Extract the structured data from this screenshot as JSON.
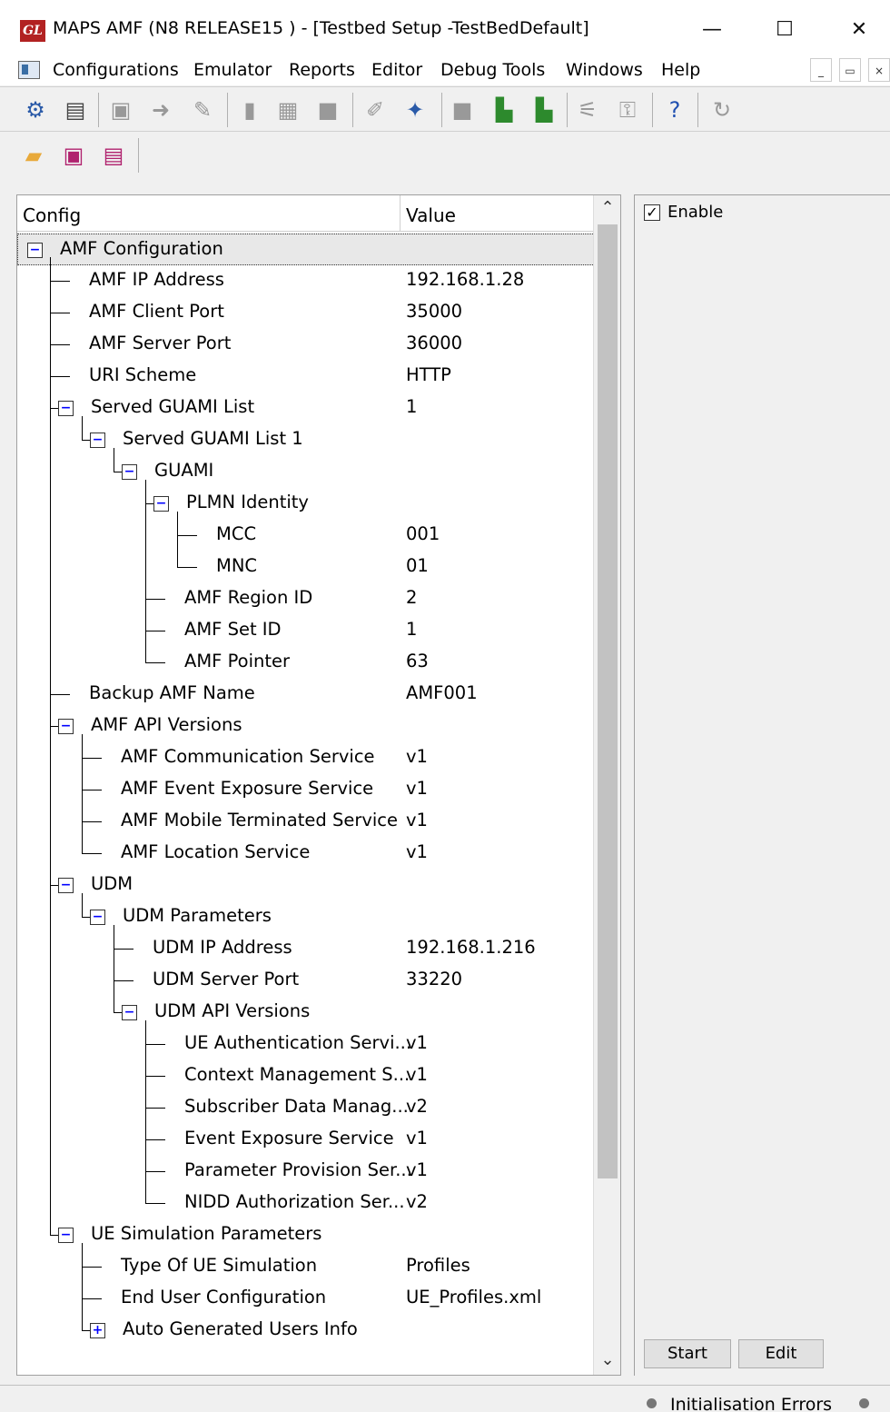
{
  "window": {
    "title": "MAPS AMF (N8 RELEASE15 ) - [Testbed Setup -TestBedDefault]",
    "logo_text": "GL",
    "minimize": "—",
    "maximize": "☐",
    "close": "✕"
  },
  "menu": {
    "items": [
      "Configurations",
      "Emulator",
      "Reports",
      "Editor",
      "Debug Tools",
      "Windows",
      "Help"
    ],
    "mdi_min": "_",
    "mdi_restore": "▭",
    "mdi_close": "×"
  },
  "tree": {
    "headers": {
      "config": "Config",
      "value": "Value"
    },
    "rows": [
      {
        "label": "AMF Configuration",
        "value": ""
      },
      {
        "label": "AMF IP Address",
        "value": "192.168.1.28"
      },
      {
        "label": "AMF Client Port",
        "value": "35000"
      },
      {
        "label": "AMF Server Port",
        "value": "36000"
      },
      {
        "label": "URI Scheme",
        "value": "HTTP"
      },
      {
        "label": "Served GUAMI List",
        "value": "1"
      },
      {
        "label": "Served GUAMI List 1",
        "value": ""
      },
      {
        "label": "GUAMI",
        "value": ""
      },
      {
        "label": "PLMN Identity",
        "value": ""
      },
      {
        "label": "MCC",
        "value": "001"
      },
      {
        "label": "MNC",
        "value": "01"
      },
      {
        "label": "AMF Region ID",
        "value": "2"
      },
      {
        "label": "AMF Set ID",
        "value": "1"
      },
      {
        "label": "AMF Pointer",
        "value": "63"
      },
      {
        "label": "Backup AMF Name",
        "value": "AMF001"
      },
      {
        "label": "AMF API Versions",
        "value": ""
      },
      {
        "label": "AMF Communication Service",
        "value": "v1"
      },
      {
        "label": "AMF Event Exposure Service",
        "value": "v1"
      },
      {
        "label": "AMF Mobile Terminated Service",
        "value": "v1"
      },
      {
        "label": "AMF  Location Service",
        "value": "v1"
      },
      {
        "label": "UDM",
        "value": ""
      },
      {
        "label": "UDM Parameters",
        "value": ""
      },
      {
        "label": "UDM IP Address",
        "value": "192.168.1.216"
      },
      {
        "label": "UDM Server Port",
        "value": "33220"
      },
      {
        "label": "UDM API Versions",
        "value": ""
      },
      {
        "label": "UE Authentication Servi...",
        "value": "v1"
      },
      {
        "label": "Context Management S...",
        "value": "v1"
      },
      {
        "label": "Subscriber Data Manag...",
        "value": "v2"
      },
      {
        "label": "Event Exposure Service",
        "value": "v1"
      },
      {
        "label": "Parameter Provision Ser...",
        "value": "v1"
      },
      {
        "label": "NIDD Authorization Ser...",
        "value": "v2"
      },
      {
        "label": "UE Simulation Parameters",
        "value": ""
      },
      {
        "label": "Type Of UE Simulation",
        "value": "Profiles"
      },
      {
        "label": "End User Configuration",
        "value": "UE_Profiles.xml"
      },
      {
        "label": "Auto Generated Users Info",
        "value": ""
      }
    ]
  },
  "right_panel": {
    "enable_label": "Enable",
    "enable_checked": "✓",
    "start_button": "Start",
    "edit_button": "Edit"
  },
  "status": {
    "text": "Initialisation Errors"
  },
  "toolbar": {
    "icons": [
      "settings-gear-icon",
      "notebook-icon",
      "load-icon",
      "run-icon",
      "edit-run-icon",
      "stop-icon",
      "paste-icon",
      "blank-icon",
      "pen-icon",
      "wand-icon",
      "gray-block-icon",
      "doc-c-icon",
      "doc-p-icon",
      "tree-edit-icon",
      "tree-lock-icon",
      "help-icon",
      "refresh-icon"
    ],
    "file_icons": [
      "open-folder-icon",
      "save-icon",
      "save-as-icon"
    ]
  }
}
